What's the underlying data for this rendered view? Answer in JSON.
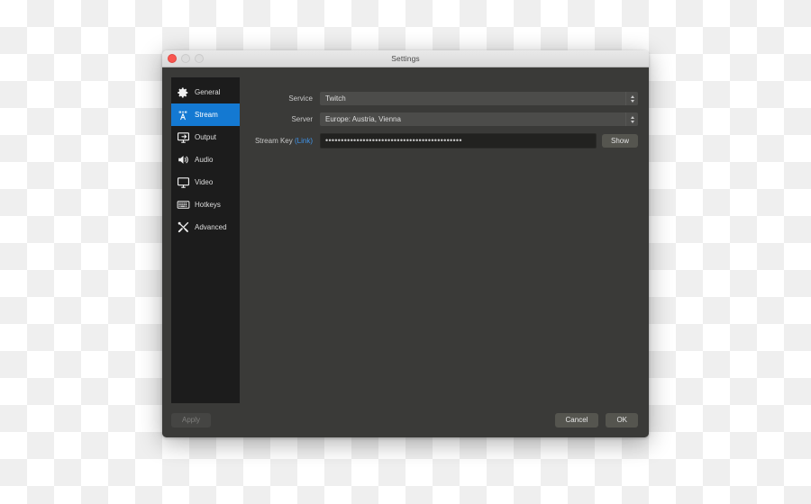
{
  "window": {
    "title": "Settings",
    "traffic_lights": [
      {
        "name": "close",
        "color": "#f9564f",
        "enabled": true
      },
      {
        "name": "minimize",
        "color": "#dcdcdc",
        "enabled": false
      },
      {
        "name": "maximize",
        "color": "#dcdcdc",
        "enabled": false
      }
    ]
  },
  "sidebar": {
    "items": [
      {
        "label": "General",
        "icon": "gear-icon",
        "selected": false
      },
      {
        "label": "Stream",
        "icon": "broadcast-icon",
        "selected": true
      },
      {
        "label": "Output",
        "icon": "monitor-out-icon",
        "selected": false
      },
      {
        "label": "Audio",
        "icon": "speaker-icon",
        "selected": false
      },
      {
        "label": "Video",
        "icon": "display-icon",
        "selected": false
      },
      {
        "label": "Hotkeys",
        "icon": "keyboard-icon",
        "selected": false
      },
      {
        "label": "Advanced",
        "icon": "tools-icon",
        "selected": false
      }
    ],
    "selected_accent": "#1479d2"
  },
  "main": {
    "service": {
      "label": "Service",
      "value": "Twitch"
    },
    "server": {
      "label": "Server",
      "value": "Europe: Austria, Vienna"
    },
    "stream_key": {
      "label": "Stream Key",
      "link_label": "(Link)",
      "link_color": "#3f93e8",
      "masked_value": "••••••••••••••••••••••••••••••••••••••••••••",
      "show_button": "Show"
    }
  },
  "footer": {
    "apply_label": "Apply",
    "apply_enabled": false,
    "cancel_label": "Cancel",
    "ok_label": "OK"
  }
}
